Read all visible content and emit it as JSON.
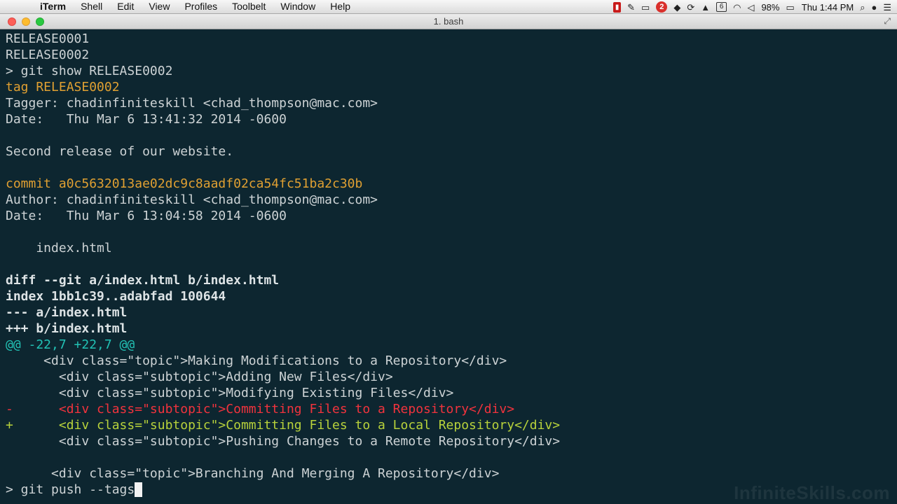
{
  "menubar": {
    "apple": "",
    "app_name": "iTerm",
    "items": [
      "Shell",
      "Edit",
      "View",
      "Profiles",
      "Toolbelt",
      "Window",
      "Help"
    ],
    "status": {
      "notification_count": "2",
      "input_indicator": "6",
      "battery": "98%",
      "clock": "Thu 1:44 PM"
    }
  },
  "window": {
    "title": "1. bash"
  },
  "terminal": {
    "lines": [
      [
        {
          "t": "RELEASE0001",
          "c": "text"
        }
      ],
      [
        {
          "t": "RELEASE0002",
          "c": "text"
        }
      ],
      [
        {
          "t": "> git show RELEASE0002",
          "c": "text"
        }
      ],
      [
        {
          "t": "tag RELEASE0002",
          "c": "yellow"
        }
      ],
      [
        {
          "t": "Tagger: chadinfiniteskill <chad_thompson@mac.com>",
          "c": "text"
        }
      ],
      [
        {
          "t": "Date:   Thu Mar 6 13:41:32 2014 -0600",
          "c": "text"
        }
      ],
      [
        {
          "t": "",
          "c": "text"
        }
      ],
      [
        {
          "t": "Second release of our website.",
          "c": "text"
        }
      ],
      [
        {
          "t": "",
          "c": "text"
        }
      ],
      [
        {
          "t": "commit a0c5632013ae02dc9c8aadf02ca54fc51ba2c30b",
          "c": "yellow"
        }
      ],
      [
        {
          "t": "Author: chadinfiniteskill <chad_thompson@mac.com>",
          "c": "text"
        }
      ],
      [
        {
          "t": "Date:   Thu Mar 6 13:04:58 2014 -0600",
          "c": "text"
        }
      ],
      [
        {
          "t": "",
          "c": "text"
        }
      ],
      [
        {
          "t": "    index.html",
          "c": "text"
        }
      ],
      [
        {
          "t": "",
          "c": "text"
        }
      ],
      [
        {
          "t": "diff --git a/index.html b/index.html",
          "c": "bold"
        }
      ],
      [
        {
          "t": "index 1bb1c39..adabfad 100644",
          "c": "bold"
        }
      ],
      [
        {
          "t": "--- a/index.html",
          "c": "bold"
        }
      ],
      [
        {
          "t": "+++ b/index.html",
          "c": "bold"
        }
      ],
      [
        {
          "t": "@@ -22,7 +22,7 @@",
          "c": "cyan"
        }
      ],
      [
        {
          "t": "     <div class=\"topic\">Making Modifications to a Repository</div>",
          "c": "text"
        }
      ],
      [
        {
          "t": "       <div class=\"subtopic\">Adding New Files</div>",
          "c": "text"
        }
      ],
      [
        {
          "t": "       <div class=\"subtopic\">Modifying Existing Files</div>",
          "c": "text"
        }
      ],
      [
        {
          "t": "-      <div class=\"subtopic\">Committing Files to a Repository</div>",
          "c": "red"
        }
      ],
      [
        {
          "t": "+      <div class=\"subtopic\">Committing Files to a Local Repository</div>",
          "c": "green"
        }
      ],
      [
        {
          "t": "       <div class=\"subtopic\">Pushing Changes to a Remote Repository</div>",
          "c": "text"
        }
      ],
      [
        {
          "t": "",
          "c": "text"
        }
      ],
      [
        {
          "t": "      <div class=\"topic\">Branching And Merging A Repository</div>",
          "c": "text"
        }
      ]
    ],
    "prompt": "> git push --tags"
  },
  "watermark": "InfiniteSkills.com"
}
